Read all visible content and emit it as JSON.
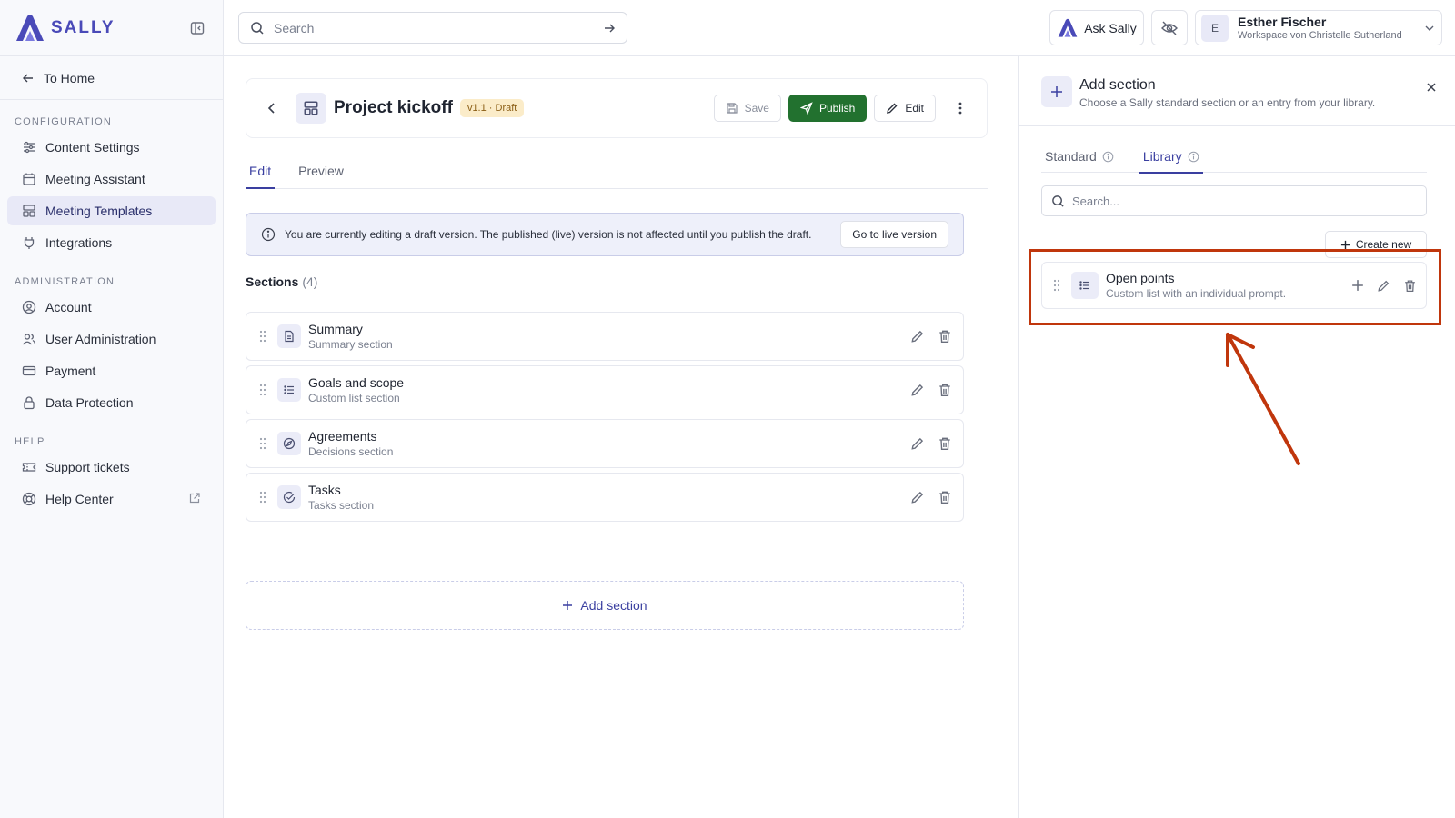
{
  "brand": {
    "name": "SALLY",
    "color": "#4a4ab8"
  },
  "sidebar": {
    "home_label": "To Home",
    "groups": [
      {
        "label": "CONFIGURATION",
        "items": [
          {
            "label": "Content Settings",
            "icon": "sliders-icon"
          },
          {
            "label": "Meeting Assistant",
            "icon": "calendar-icon"
          },
          {
            "label": "Meeting Templates",
            "icon": "template-icon",
            "active": true
          },
          {
            "label": "Integrations",
            "icon": "plug-icon"
          }
        ]
      },
      {
        "label": "ADMINISTRATION",
        "items": [
          {
            "label": "Account",
            "icon": "user-circle-icon"
          },
          {
            "label": "User Administration",
            "icon": "users-icon"
          },
          {
            "label": "Payment",
            "icon": "credit-card-icon"
          },
          {
            "label": "Data Protection",
            "icon": "lock-icon"
          }
        ]
      },
      {
        "label": "HELP",
        "items": [
          {
            "label": "Support tickets",
            "icon": "ticket-icon"
          },
          {
            "label": "Help Center",
            "icon": "lifebuoy-icon",
            "external": true
          }
        ]
      }
    ]
  },
  "topbar": {
    "search_placeholder": "Search",
    "ask_label": "Ask Sally",
    "user": {
      "initial": "E",
      "name": "Esther Fischer",
      "workspace": "Workspace von Christelle Sutherland"
    }
  },
  "template": {
    "title": "Project kickoff",
    "badge": "v1.1 · Draft",
    "save_label": "Save",
    "publish_label": "Publish",
    "edit_label": "Edit",
    "publish_color": "#22712f"
  },
  "tabs": [
    {
      "label": "Edit",
      "active": true
    },
    {
      "label": "Preview",
      "active": false
    }
  ],
  "banner": {
    "text": "You are currently editing a draft version. The published (live) version is not affected until you publish the draft.",
    "button": "Go to live version"
  },
  "sections": {
    "label": "Sections",
    "count": "(4)",
    "items": [
      {
        "title": "Summary",
        "subtitle": "Summary section",
        "icon": "document-icon"
      },
      {
        "title": "Goals and scope",
        "subtitle": "Custom list section",
        "icon": "list-icon"
      },
      {
        "title": "Agreements",
        "subtitle": "Decisions section",
        "icon": "compass-icon"
      },
      {
        "title": "Tasks",
        "subtitle": "Tasks section",
        "icon": "check-circle-icon"
      }
    ],
    "add_label": "Add section"
  },
  "panel": {
    "title": "Add section",
    "subtitle": "Choose a Sally standard section or an entry from your library.",
    "tabs": [
      {
        "label": "Standard",
        "active": false
      },
      {
        "label": "Library",
        "active": true
      }
    ],
    "search_placeholder": "Search...",
    "create_label": "Create new",
    "library_item": {
      "title": "Open points",
      "subtitle": "Custom list with an individual prompt."
    }
  },
  "annotation_color": "#c0360c"
}
